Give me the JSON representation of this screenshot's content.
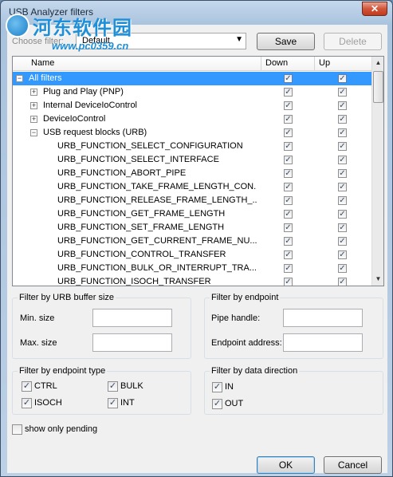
{
  "window": {
    "title": "USB Analyzer filters",
    "close_glyph": "✕"
  },
  "watermark": {
    "brand": "河东软件园",
    "url": "www.pc0359.cn"
  },
  "filter": {
    "choose_label": "Choose filter:",
    "selected_value": "Default",
    "save_label": "Save",
    "delete_label": "Delete"
  },
  "grid": {
    "columns": {
      "name": "Name",
      "down": "Down",
      "up": "Up"
    },
    "rows": [
      {
        "label": "All filters",
        "expander": "−",
        "down": "✓",
        "up": "✓"
      },
      {
        "label": "Plug and Play (PNP)",
        "expander": "+",
        "down": "✓",
        "up": "✓"
      },
      {
        "label": "Internal DeviceIoControl",
        "expander": "+",
        "down": "✓",
        "up": "✓"
      },
      {
        "label": "DeviceIoControl",
        "expander": "+",
        "down": "✓",
        "up": "✓"
      },
      {
        "label": "USB request blocks (URB)",
        "expander": "−",
        "down": "✓",
        "up": "✓"
      },
      {
        "label": "URB_FUNCTION_SELECT_CONFIGURATION",
        "down": "✓",
        "up": "✓"
      },
      {
        "label": "URB_FUNCTION_SELECT_INTERFACE",
        "down": "✓",
        "up": "✓"
      },
      {
        "label": "URB_FUNCTION_ABORT_PIPE",
        "down": "✓",
        "up": "✓"
      },
      {
        "label": "URB_FUNCTION_TAKE_FRAME_LENGTH_CON...",
        "down": "✓",
        "up": "✓"
      },
      {
        "label": "URB_FUNCTION_RELEASE_FRAME_LENGTH_...",
        "down": "✓",
        "up": "✓"
      },
      {
        "label": "URB_FUNCTION_GET_FRAME_LENGTH",
        "down": "✓",
        "up": "✓"
      },
      {
        "label": "URB_FUNCTION_SET_FRAME_LENGTH",
        "down": "✓",
        "up": "✓"
      },
      {
        "label": "URB_FUNCTION_GET_CURRENT_FRAME_NU...",
        "down": "✓",
        "up": "✓"
      },
      {
        "label": "URB_FUNCTION_CONTROL_TRANSFER",
        "down": "✓",
        "up": "✓"
      },
      {
        "label": "URB_FUNCTION_BULK_OR_INTERRUPT_TRA...",
        "down": "✓",
        "up": "✓"
      },
      {
        "label": "URB_FUNCTION_ISOCH_TRANSFER",
        "down": "✓",
        "up": "✓"
      }
    ],
    "scroll_up": "▲",
    "scroll_down": "▼"
  },
  "urb_size": {
    "title": "Filter by URB buffer size",
    "min_label": "Min. size",
    "max_label": "Max. size",
    "min_value": "",
    "max_value": ""
  },
  "endpoint": {
    "title": "Filter by endpoint",
    "pipe_label": "Pipe handle:",
    "address_label": "Endpoint address:",
    "pipe_value": "",
    "address_value": ""
  },
  "endpoint_type": {
    "title": "Filter by endpoint type",
    "items": [
      {
        "label": "CTRL",
        "check": "✓"
      },
      {
        "label": "BULK",
        "check": "✓"
      },
      {
        "label": "ISOCH",
        "check": "✓"
      },
      {
        "label": "INT",
        "check": "✓"
      }
    ]
  },
  "direction": {
    "title": "Filter by data direction",
    "items": [
      {
        "label": "IN",
        "check": "✓"
      },
      {
        "label": "OUT",
        "check": "✓"
      }
    ]
  },
  "pending": {
    "label": "show only pending",
    "check": ""
  },
  "buttons": {
    "ok": "OK",
    "cancel": "Cancel"
  }
}
